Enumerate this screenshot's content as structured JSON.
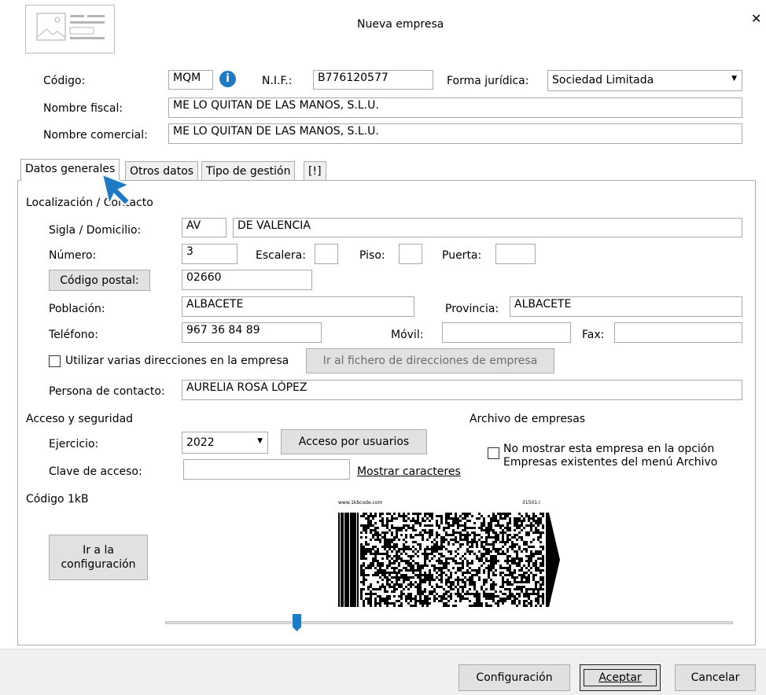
{
  "window": {
    "title": "Nueva empresa",
    "close_glyph": "✕"
  },
  "header": {
    "codigo_label": "Código:",
    "codigo_value": "MQM",
    "nif_label": "N.I.F.:",
    "nif_value": "B776120577",
    "forma_label": "Forma jurídica:",
    "forma_value": "Sociedad Limitada",
    "nombre_fiscal_label": "Nombre fiscal:",
    "nombre_fiscal_value": "ME LO QUITAN DE LAS MANOS, S.L.U.",
    "nombre_comercial_label": "Nombre comercial:",
    "nombre_comercial_value": "ME LO QUITAN DE LAS MANOS, S.L.U."
  },
  "tabs": [
    {
      "label": "Datos generales",
      "active": true
    },
    {
      "label": "Otros datos",
      "active": false
    },
    {
      "label": "Tipo de gestión",
      "active": false
    },
    {
      "label": "[!]",
      "active": false
    }
  ],
  "localizacion": {
    "title": "Localización / Contacto",
    "sigla_label": "Sigla / Domicilio:",
    "sigla_value": "AV",
    "domicilio_value": "DE VALENCIA",
    "numero_label": "Número:",
    "numero_value": "3",
    "escalera_label": "Escalera:",
    "escalera_value": "",
    "piso_label": "Piso:",
    "piso_value": "",
    "puerta_label": "Puerta:",
    "puerta_value": "",
    "cp_button": "Código postal:",
    "cp_value": "02660",
    "poblacion_label": "Población:",
    "poblacion_value": "ALBACETE",
    "provincia_label": "Provincia:",
    "provincia_value": "ALBACETE",
    "telefono_label": "Teléfono:",
    "telefono_value": "967 36 84 89",
    "movil_label": "Móvil:",
    "movil_value": "",
    "fax_label": "Fax:",
    "fax_value": "",
    "varias_dir_label": "Utilizar varias direcciones en la empresa",
    "ir_fichero_button": "Ir al fichero de direcciones de empresa",
    "persona_label": "Persona de contacto:",
    "persona_value": "AURELIA ROSA LÓPEZ"
  },
  "acceso": {
    "title": "Acceso y seguridad",
    "ejercicio_label": "Ejercicio:",
    "ejercicio_value": "2022",
    "acceso_usuarios_button": "Acceso por usuarios",
    "clave_label": "Clave de acceso:",
    "clave_value": "",
    "mostrar_link": "Mostrar caracteres"
  },
  "archivo": {
    "title": "Archivo de empresas",
    "no_mostrar_line1": "No mostrar esta empresa en la opción",
    "no_mostrar_line2": "Empresas existentes del menú Archivo"
  },
  "codigo1kb": {
    "title": "Código 1kB",
    "ir_config_line1": "Ir a la",
    "ir_config_line2": "configuración",
    "barcode_url": "www.1kbcode.com",
    "barcode_id": "31501.I"
  },
  "footer": {
    "configuracion": "Configuración",
    "aceptar": "Aceptar",
    "cancelar": "Cancelar"
  },
  "colors": {
    "accent": "#1e7ac4",
    "info": "#1e7ac4",
    "dialog_bg": "#ffffff",
    "panel_bg": "#f0f0f0"
  }
}
